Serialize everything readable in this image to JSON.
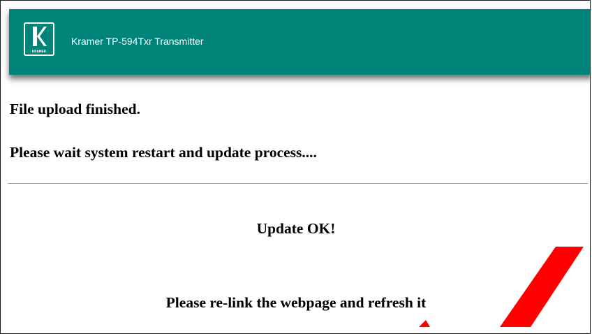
{
  "header": {
    "logo_text": "KRAMER",
    "title": "Kramer TP-594Txr Transmitter",
    "background_color": "#00847a"
  },
  "main": {
    "line1": "File upload finished.",
    "line2": "Please wait system restart and update process....",
    "status": "Update OK!",
    "instruction": "Please re-link the webpage and refresh it"
  },
  "overlay": {
    "icon": "red-diagonal-watermark-stroke",
    "color": "#ff0000"
  }
}
